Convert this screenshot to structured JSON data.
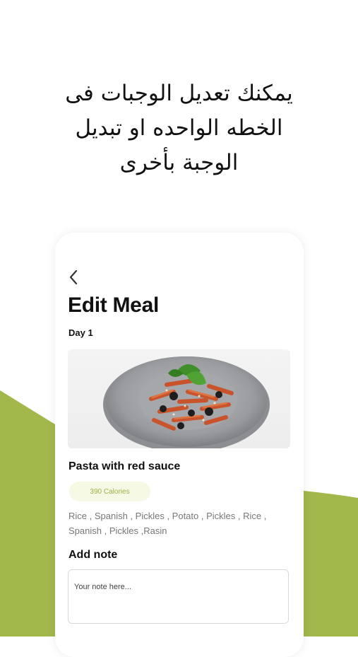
{
  "headline": {
    "line1": "يمكنك تعديل الوجبات فى",
    "line2": "الخطه الواحده او تبديل",
    "line3": "الوجبة بأخرى"
  },
  "colors": {
    "accent_green": "#a2b84b",
    "calorie_badge_bg": "#f6f9e3",
    "calorie_text": "#9bb14a"
  },
  "screen": {
    "back_icon": "chevron-left-icon",
    "title": "Edit Meal",
    "day_label": "Day 1",
    "meal": {
      "name": "Pasta with red sauce",
      "calories": "390 Calories",
      "ingredients": "Rice , Spanish , Pickles , Potato , Pickles , Rice , Spanish , Pickles ,Rasin"
    },
    "note": {
      "label": "Add note",
      "placeholder": "Your note here..."
    }
  }
}
